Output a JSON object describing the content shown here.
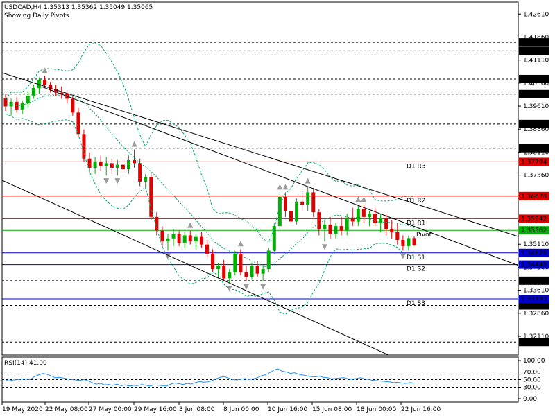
{
  "header": {
    "symbol_line": "USDCAD,H4  1.35313 1.35362 1.35049 1.35065",
    "pivots_note": "Showing Daily Pivots."
  },
  "chart_data": {
    "type": "candlestick",
    "price_axis": {
      "ticks": [
        "1.42610",
        "1.41860",
        "1.41110",
        "1.40360",
        "1.39610",
        "1.38860",
        "1.38110",
        "1.37360",
        "1.36610",
        "1.35860",
        "1.35110",
        "1.34360",
        "1.33610",
        "1.32860",
        "1.32110"
      ],
      "range": [
        1.315,
        1.43
      ]
    },
    "time_axis": [
      "19 May 2020",
      "22 May 08:00",
      "27 May 00:00",
      "29 May 16:00",
      "3 Jun 08:00",
      "8 Jun 00:00",
      "10 Jun 16:00",
      "15 Jun 08:00",
      "18 Jun 00:00",
      "22 Jun 16:00"
    ],
    "pivot_lines": [
      {
        "price": 1.37794,
        "label": "1.37794",
        "name": "D1 R3",
        "color": "#e00000"
      },
      {
        "price": 1.36678,
        "label": "1.36678",
        "name": "D1 R2",
        "color": "#e00000"
      },
      {
        "price": 1.35942,
        "label": "1.35942",
        "name": "D1 R1",
        "color": "#e00000"
      },
      {
        "price": 1.35562,
        "label": "1.35562",
        "name": "Pivot",
        "color": "#00b000"
      },
      {
        "price": 1.34826,
        "label": "1.34826",
        "name": "D1 S1",
        "color": "#0000cc"
      },
      {
        "price": 1.34446,
        "label": "1.34446",
        "name": "D1 S2",
        "color": "#0000cc"
      },
      {
        "price": 1.3333,
        "label": "1.33330",
        "name": "D1 S3",
        "color": "#0000cc"
      }
    ],
    "level_lines": [
      {
        "price": 1.41687,
        "label": "1.41687"
      },
      {
        "price": 1.4141,
        "label": "1.41410"
      },
      {
        "price": 1.40493,
        "label": "1.40493"
      },
      {
        "price": 1.4,
        "label": "1.40000"
      },
      {
        "price": 1.39027,
        "label": "1.39027"
      },
      {
        "price": 1.38238,
        "label": "1.38238"
      },
      {
        "price": 1.33921,
        "label": "1.33921"
      },
      {
        "price": 1.33115,
        "label": "1.33115"
      },
      {
        "price": 1.31924,
        "label": "1.31924"
      }
    ],
    "rsi": {
      "label": "RSI(14) 41.00",
      "ticks": [
        "100.00",
        "70.00",
        "50.00",
        "30.00",
        "0.00"
      ],
      "levels": [
        100,
        70,
        50,
        30,
        0
      ],
      "values": [
        48,
        47,
        49,
        50,
        52,
        51,
        50,
        58,
        62,
        66,
        64,
        60,
        55,
        56,
        54,
        52,
        50,
        49,
        48,
        50,
        47,
        42,
        38,
        40,
        36,
        37,
        35,
        38,
        34,
        36,
        33,
        35,
        34,
        37,
        35,
        33,
        36,
        35,
        34,
        33,
        38,
        41,
        39,
        37,
        40,
        38,
        42,
        45,
        43,
        44,
        47,
        52,
        56,
        58,
        54,
        50,
        49,
        51,
        53,
        50,
        52,
        55,
        60,
        63,
        68,
        75,
        78,
        72,
        70,
        66,
        68,
        64,
        62,
        60,
        58,
        57,
        59,
        56,
        55,
        52,
        53,
        54,
        55,
        52,
        51,
        53,
        55,
        52,
        50,
        48,
        47,
        46,
        45,
        44,
        42,
        43,
        41,
        40,
        42,
        41
      ]
    },
    "colors": {
      "bull": "#00b000",
      "bear": "#e00000",
      "band": "#00aa66",
      "trend": "#000000"
    },
    "ohlc": [
      [
        1.3988,
        1.4,
        1.3945,
        1.396
      ],
      [
        1.396,
        1.3985,
        1.393,
        1.3975
      ],
      [
        1.3975,
        1.399,
        1.394,
        1.395
      ],
      [
        1.395,
        1.398,
        1.3935,
        1.397
      ],
      [
        1.397,
        1.401,
        1.3955,
        1.3995
      ],
      [
        1.3995,
        1.403,
        1.3985,
        1.402
      ],
      [
        1.402,
        1.4055,
        1.4,
        1.4045
      ],
      [
        1.4045,
        1.406,
        1.402,
        1.403
      ],
      [
        1.403,
        1.404,
        1.4005,
        1.4015
      ],
      [
        1.4015,
        1.403,
        1.3995,
        1.4005
      ],
      [
        1.4005,
        1.4025,
        1.3985,
        1.4
      ],
      [
        1.4,
        1.401,
        1.397,
        1.3985
      ],
      [
        1.3985,
        1.3995,
        1.393,
        1.394
      ],
      [
        1.394,
        1.3955,
        1.386,
        1.387
      ],
      [
        1.387,
        1.3885,
        1.378,
        1.379
      ],
      [
        1.379,
        1.381,
        1.3745,
        1.376
      ],
      [
        1.376,
        1.3795,
        1.374,
        1.378
      ],
      [
        1.378,
        1.38,
        1.375,
        1.3765
      ],
      [
        1.3765,
        1.3795,
        1.3735,
        1.3775
      ],
      [
        1.3775,
        1.379,
        1.374,
        1.376
      ],
      [
        1.376,
        1.3785,
        1.3735,
        1.377
      ],
      [
        1.377,
        1.379,
        1.3745,
        1.3755
      ],
      [
        1.3755,
        1.38,
        1.374,
        1.3785
      ],
      [
        1.3785,
        1.382,
        1.376,
        1.3775
      ],
      [
        1.3775,
        1.379,
        1.37,
        1.3715
      ],
      [
        1.3715,
        1.374,
        1.369,
        1.373
      ],
      [
        1.373,
        1.3745,
        1.359,
        1.36
      ],
      [
        1.36,
        1.3615,
        1.354,
        1.3555
      ],
      [
        1.3555,
        1.357,
        1.35,
        1.352
      ],
      [
        1.352,
        1.3545,
        1.349,
        1.353
      ],
      [
        1.353,
        1.356,
        1.3505,
        1.3545
      ],
      [
        1.3545,
        1.3555,
        1.3505,
        1.3515
      ],
      [
        1.3515,
        1.355,
        1.35,
        1.354
      ],
      [
        1.354,
        1.3555,
        1.351,
        1.352
      ],
      [
        1.352,
        1.3545,
        1.3495,
        1.3535
      ],
      [
        1.3535,
        1.355,
        1.35,
        1.351
      ],
      [
        1.351,
        1.3525,
        1.347,
        1.348
      ],
      [
        1.348,
        1.3495,
        1.342,
        1.343
      ],
      [
        1.343,
        1.345,
        1.34,
        1.344
      ],
      [
        1.344,
        1.346,
        1.339,
        1.34
      ],
      [
        1.34,
        1.343,
        1.3385,
        1.342
      ],
      [
        1.342,
        1.349,
        1.341,
        1.348
      ],
      [
        1.348,
        1.3495,
        1.341,
        1.342
      ],
      [
        1.342,
        1.344,
        1.339,
        1.3405
      ],
      [
        1.3405,
        1.345,
        1.3395,
        1.344
      ],
      [
        1.344,
        1.3455,
        1.3405,
        1.3415
      ],
      [
        1.3415,
        1.3445,
        1.339,
        1.343
      ],
      [
        1.343,
        1.35,
        1.342,
        1.349
      ],
      [
        1.349,
        1.358,
        1.348,
        1.357
      ],
      [
        1.357,
        1.368,
        1.356,
        1.3665
      ],
      [
        1.3665,
        1.368,
        1.36,
        1.362
      ],
      [
        1.362,
        1.365,
        1.357,
        1.3585
      ],
      [
        1.3585,
        1.366,
        1.3575,
        1.365
      ],
      [
        1.365,
        1.369,
        1.362,
        1.364
      ],
      [
        1.364,
        1.37,
        1.362,
        1.368
      ],
      [
        1.368,
        1.3695,
        1.36,
        1.3615
      ],
      [
        1.3615,
        1.3625,
        1.354,
        1.356
      ],
      [
        1.356,
        1.359,
        1.352,
        1.3575
      ],
      [
        1.3575,
        1.36,
        1.353,
        1.3545
      ],
      [
        1.3545,
        1.358,
        1.353,
        1.357
      ],
      [
        1.357,
        1.36,
        1.354,
        1.3555
      ],
      [
        1.3555,
        1.361,
        1.354,
        1.3595
      ],
      [
        1.3595,
        1.363,
        1.357,
        1.3585
      ],
      [
        1.3585,
        1.364,
        1.357,
        1.3625
      ],
      [
        1.3625,
        1.364,
        1.358,
        1.36
      ],
      [
        1.36,
        1.362,
        1.357,
        1.361
      ],
      [
        1.361,
        1.363,
        1.357,
        1.358
      ],
      [
        1.358,
        1.361,
        1.355,
        1.3595
      ],
      [
        1.3595,
        1.361,
        1.354,
        1.356
      ],
      [
        1.356,
        1.359,
        1.353,
        1.355
      ],
      [
        1.355,
        1.358,
        1.351,
        1.3525
      ],
      [
        1.3525,
        1.354,
        1.349,
        1.3505
      ],
      [
        1.3505,
        1.354,
        1.349,
        1.3531
      ],
      [
        1.3531,
        1.3536,
        1.3505,
        1.3507
      ]
    ]
  }
}
